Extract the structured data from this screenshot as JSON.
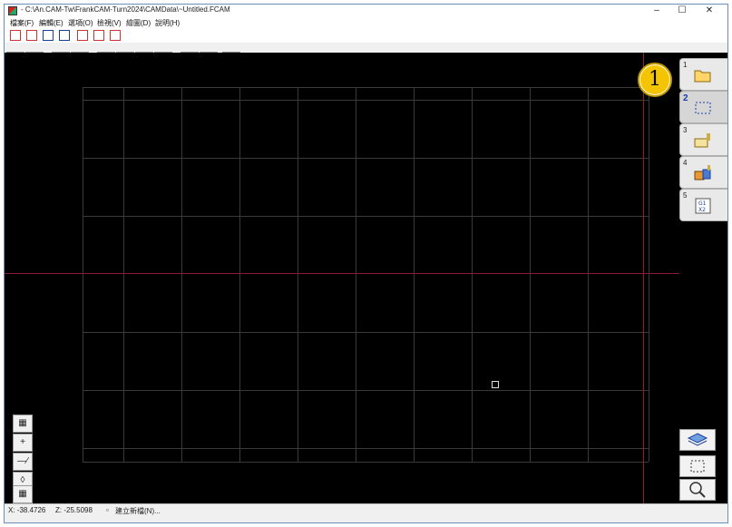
{
  "window": {
    "title": "- C:\\An.CAM-Tw\\FrankCAM-Turn2024\\CAMData\\~Untitled.FCAM",
    "minimize": "–",
    "maximize": "☐",
    "close": "✕"
  },
  "menu": [
    "檔案(F)",
    "編輯(E)",
    "選項(O)",
    "檢視(V)",
    "繪圖(D)",
    "說明(H)"
  ],
  "toolbar2": {
    "undo": "↶",
    "redo": "↷",
    "point": "•",
    "line": "╱",
    "circle": "◯",
    "arc": "◝",
    "fillet": "⌐",
    "snap": "◆"
  },
  "steps": [
    {
      "num": "1",
      "icon": "open-folder-icon"
    },
    {
      "num": "2",
      "icon": "stock-boundary-icon"
    },
    {
      "num": "3",
      "icon": "tool-setup-icon"
    },
    {
      "num": "4",
      "icon": "toolpath-icon"
    },
    {
      "num": "5",
      "icon": "gcode-icon"
    }
  ],
  "badge": "1",
  "left_tools": [
    "▦",
    "+",
    "—∕",
    "◊",
    "▦"
  ],
  "status": {
    "x": "X: -38.4726",
    "z": "Z: -25.5098",
    "message": "建立新檔(N)..."
  },
  "colors": {
    "canvas": "#000000",
    "grid": "#3a3a3a",
    "axis": "#a01828",
    "badge": "#f4c400"
  }
}
